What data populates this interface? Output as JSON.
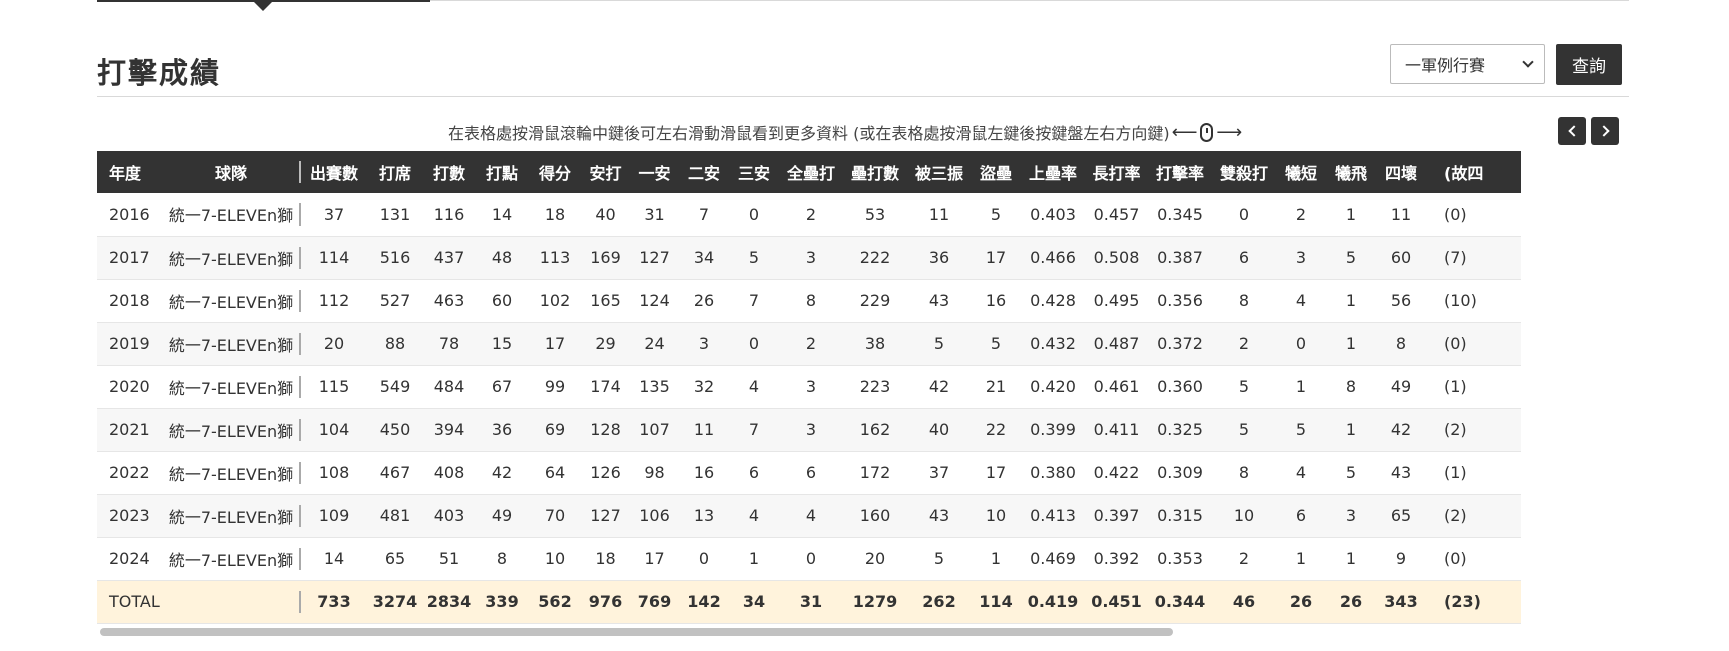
{
  "section": {
    "title": "打擊成績"
  },
  "filter": {
    "season_selected": "一軍例行賽",
    "query_label": "查詢"
  },
  "hint": {
    "text": "在表格處按滑鼠滾輪中鍵後可左右滑動滑鼠看到更多資料 (或在表格處按滑鼠左鍵後按鍵盤左右方向鍵)",
    "left_arrow": "⟵",
    "right_arrow": "⟶"
  },
  "icons": {
    "prev": "chevron-left-icon",
    "next": "chevron-right-icon",
    "mouse": "mouse-icon"
  },
  "colors": {
    "header_bg": "#333333",
    "total_row_bg": "#fff3dc",
    "stripe_bg": "#f7f7f7"
  },
  "table": {
    "headers": [
      "年度",
      "球隊",
      "出賽數",
      "打席",
      "打數",
      "打點",
      "得分",
      "安打",
      "一安",
      "二安",
      "三安",
      "全壘打",
      "壘打數",
      "被三振",
      "盜壘",
      "上壘率",
      "長打率",
      "打擊率",
      "雙殺打",
      "犧短",
      "犧飛",
      "四壞",
      "(故四"
    ],
    "rows": [
      [
        "2016",
        "統一7-ELEVEn獅",
        "37",
        "131",
        "116",
        "14",
        "18",
        "40",
        "31",
        "7",
        "0",
        "2",
        "53",
        "11",
        "5",
        "0.403",
        "0.457",
        "0.345",
        "0",
        "2",
        "1",
        "11",
        "(0)"
      ],
      [
        "2017",
        "統一7-ELEVEn獅",
        "114",
        "516",
        "437",
        "48",
        "113",
        "169",
        "127",
        "34",
        "5",
        "3",
        "222",
        "36",
        "17",
        "0.466",
        "0.508",
        "0.387",
        "6",
        "3",
        "5",
        "60",
        "(7)"
      ],
      [
        "2018",
        "統一7-ELEVEn獅",
        "112",
        "527",
        "463",
        "60",
        "102",
        "165",
        "124",
        "26",
        "7",
        "8",
        "229",
        "43",
        "16",
        "0.428",
        "0.495",
        "0.356",
        "8",
        "4",
        "1",
        "56",
        "(10)"
      ],
      [
        "2019",
        "統一7-ELEVEn獅",
        "20",
        "88",
        "78",
        "15",
        "17",
        "29",
        "24",
        "3",
        "0",
        "2",
        "38",
        "5",
        "5",
        "0.432",
        "0.487",
        "0.372",
        "2",
        "0",
        "1",
        "8",
        "(0)"
      ],
      [
        "2020",
        "統一7-ELEVEn獅",
        "115",
        "549",
        "484",
        "67",
        "99",
        "174",
        "135",
        "32",
        "4",
        "3",
        "223",
        "42",
        "21",
        "0.420",
        "0.461",
        "0.360",
        "5",
        "1",
        "8",
        "49",
        "(1)"
      ],
      [
        "2021",
        "統一7-ELEVEn獅",
        "104",
        "450",
        "394",
        "36",
        "69",
        "128",
        "107",
        "11",
        "7",
        "3",
        "162",
        "40",
        "22",
        "0.399",
        "0.411",
        "0.325",
        "5",
        "5",
        "1",
        "42",
        "(2)"
      ],
      [
        "2022",
        "統一7-ELEVEn獅",
        "108",
        "467",
        "408",
        "42",
        "64",
        "126",
        "98",
        "16",
        "6",
        "6",
        "172",
        "37",
        "17",
        "0.380",
        "0.422",
        "0.309",
        "8",
        "4",
        "5",
        "43",
        "(1)"
      ],
      [
        "2023",
        "統一7-ELEVEn獅",
        "109",
        "481",
        "403",
        "49",
        "70",
        "127",
        "106",
        "13",
        "4",
        "4",
        "160",
        "43",
        "10",
        "0.413",
        "0.397",
        "0.315",
        "10",
        "6",
        "3",
        "65",
        "(2)"
      ],
      [
        "2024",
        "統一7-ELEVEn獅",
        "14",
        "65",
        "51",
        "8",
        "10",
        "18",
        "17",
        "0",
        "1",
        "0",
        "20",
        "5",
        "1",
        "0.469",
        "0.392",
        "0.353",
        "2",
        "1",
        "1",
        "9",
        "(0)"
      ]
    ],
    "total": [
      "TOTAL",
      "",
      "733",
      "3274",
      "2834",
      "339",
      "562",
      "976",
      "769",
      "142",
      "34",
      "31",
      "1279",
      "262",
      "114",
      "0.419",
      "0.451",
      "0.344",
      "46",
      "26",
      "26",
      "343",
      "(23)"
    ]
  }
}
